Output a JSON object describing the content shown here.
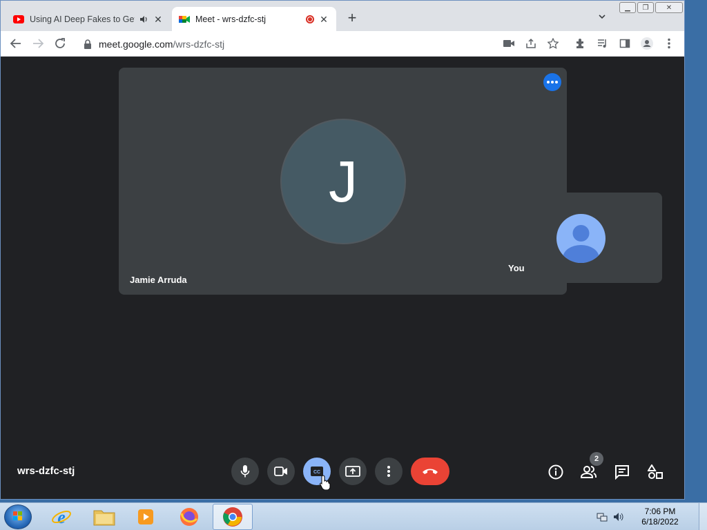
{
  "browser": {
    "tabs": [
      {
        "title": "Using AI Deep Fakes to Get F",
        "active": false,
        "icon": "youtube-icon",
        "audio": true
      },
      {
        "title": "Meet - wrs-dzfc-stj",
        "active": true,
        "icon": "google-meet-icon",
        "recording": true
      }
    ],
    "url_host": "meet.google.com",
    "url_path": "/wrs-dzfc-stj"
  },
  "meet": {
    "main_participant": {
      "initial": "J",
      "name": "Jamie Arruda"
    },
    "self_participant": {
      "name": "You"
    },
    "meeting_code": "wrs-dzfc-stj",
    "participant_count": "2",
    "controls": [
      "microphone-icon",
      "camera-icon",
      "captions-icon",
      "present-icon",
      "more-vert-icon",
      "hangup-icon"
    ],
    "right_controls": [
      "info-icon",
      "people-icon",
      "chat-icon",
      "activities-icon"
    ],
    "colors": {
      "background": "#202124",
      "tile": "#3c4043",
      "accent": "#8ab4f8",
      "hangup": "#ea4335",
      "more": "#1a73e8"
    }
  },
  "taskbar": {
    "apps": [
      "internet-explorer-icon",
      "windows-explorer-icon",
      "media-player-icon",
      "firefox-icon",
      "chrome-icon"
    ],
    "active_app": "chrome-icon",
    "time": "7:06 PM",
    "date": "6/18/2022"
  }
}
